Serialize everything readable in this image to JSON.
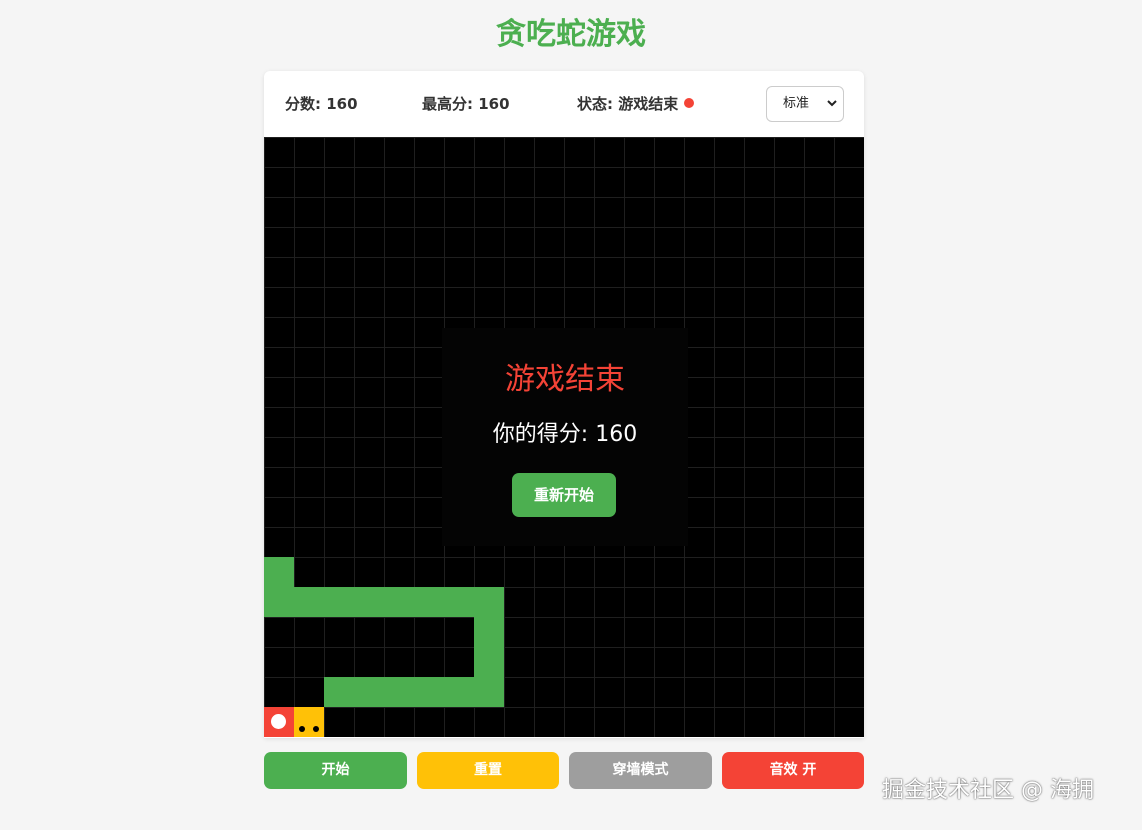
{
  "title": "贪吃蛇游戏",
  "stats": {
    "score": "分数: 160",
    "high_score": "最高分: 160",
    "status": "状态: 游戏结束"
  },
  "mode_select": {
    "selected": "标准"
  },
  "board": {
    "cols": 20,
    "rows": 20,
    "snake_head": [
      1,
      19
    ],
    "snake_body": [
      [
        2,
        18
      ],
      [
        3,
        18
      ],
      [
        4,
        18
      ],
      [
        5,
        18
      ],
      [
        6,
        18
      ],
      [
        7,
        18
      ],
      [
        7,
        17
      ],
      [
        7,
        16
      ],
      [
        7,
        15
      ],
      [
        6,
        15
      ],
      [
        5,
        15
      ],
      [
        4,
        15
      ],
      [
        3,
        15
      ],
      [
        2,
        15
      ],
      [
        1,
        15
      ],
      [
        0,
        15
      ],
      [
        0,
        14
      ]
    ],
    "food": [
      0,
      19
    ]
  },
  "overlay": {
    "title": "游戏结束",
    "score_text": "你的得分: 160",
    "restart_label": "重新开始"
  },
  "controls": {
    "start": "开始",
    "reset": "重置",
    "wall_mode": "穿墙模式",
    "sound": "音效  开"
  },
  "watermark": "掘金技术社区 @ 海拥",
  "colors": {
    "accent": "#4caf50",
    "snake": "#4caf50",
    "snake_head": "#ffc107",
    "food": "#f44336",
    "reset_button": "#ffc107",
    "wall_button": "#9e9e9e",
    "sound_button": "#f44336",
    "board": "#000000"
  }
}
